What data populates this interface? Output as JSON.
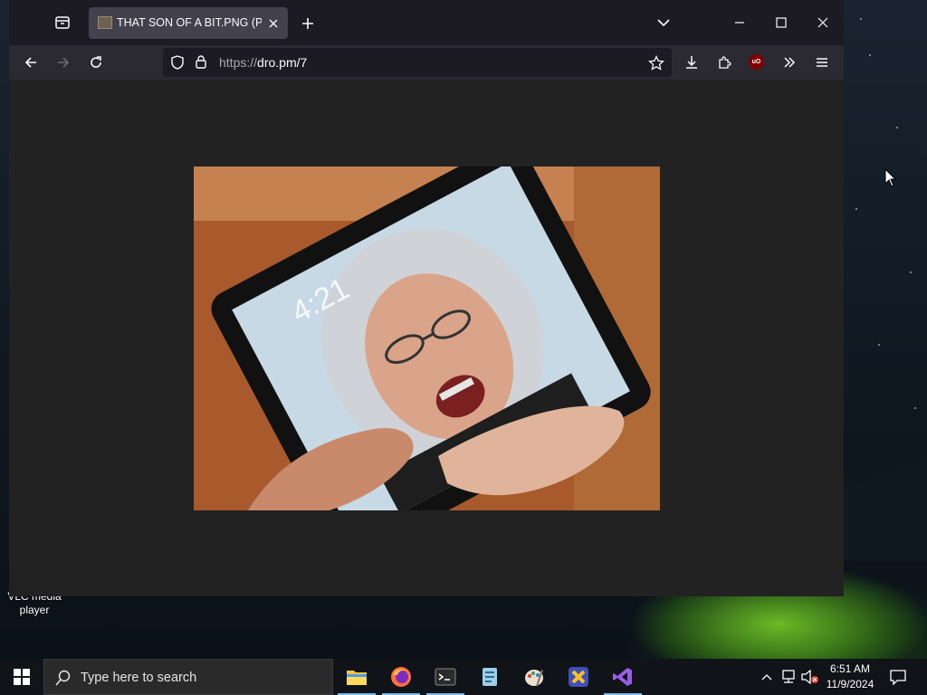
{
  "desktop": {
    "icon_label": "VLC media player"
  },
  "browser": {
    "tab": {
      "title": "THAT SON OF A BIT.PNG (PNG"
    },
    "urlbar": {
      "scheme": "https://",
      "host_path": "dro.pm/7"
    },
    "extension_badge": "uO"
  },
  "taskbar": {
    "search_placeholder": "Type here to search",
    "apps": [
      "file-explorer",
      "firefox",
      "terminal",
      "notepad",
      "paint",
      "xampp",
      "visual-studio"
    ],
    "clock": {
      "time": "6:51 AM",
      "date": "11/9/2024"
    }
  }
}
